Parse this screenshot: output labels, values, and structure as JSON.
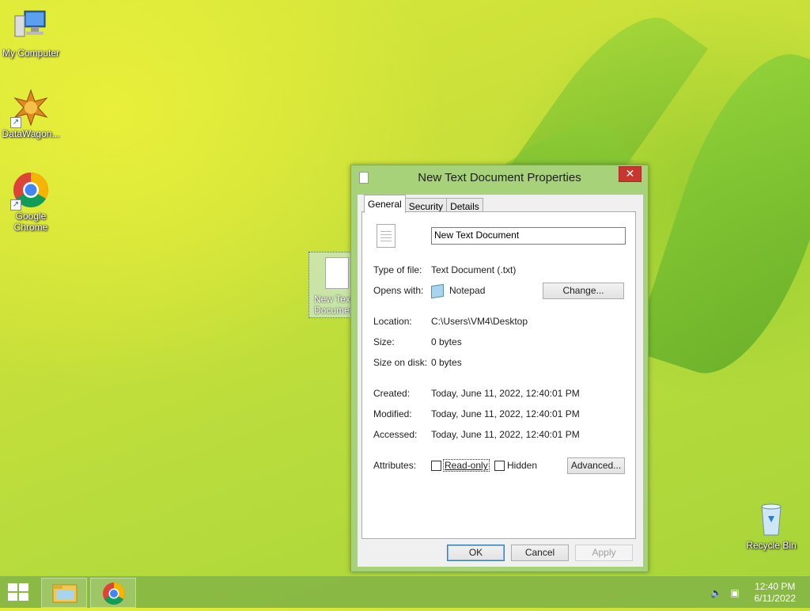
{
  "desktop": {
    "icons": [
      {
        "label": "My Computer"
      },
      {
        "label": "DataWagon..."
      },
      {
        "label": "Google Chrome"
      },
      {
        "label": "New Text Document"
      },
      {
        "label": "Recycle Bin"
      }
    ]
  },
  "dialog": {
    "title": "New Text Document Properties",
    "close_glyph": "✕",
    "tabs": [
      {
        "label": "General",
        "active": true
      },
      {
        "label": "Security"
      },
      {
        "label": "Details"
      }
    ],
    "general": {
      "file_name": "New Text Document",
      "type_label": "Type of file:",
      "type_value": "Text Document (.txt)",
      "opens_label": "Opens with:",
      "opens_value": "Notepad",
      "change_button": "Change...",
      "location_label": "Location:",
      "location_value": "C:\\Users\\VM4\\Desktop",
      "size_label": "Size:",
      "size_value": "0 bytes",
      "size_disk_label": "Size on disk:",
      "size_disk_value": "0 bytes",
      "created_label": "Created:",
      "created_value": "Today, June 11, 2022, 12:40:01 PM",
      "modified_label": "Modified:",
      "modified_value": "Today, June 11, 2022, 12:40:01 PM",
      "accessed_label": "Accessed:",
      "accessed_value": "Today, June 11, 2022, 12:40:01 PM",
      "attributes_label": "Attributes:",
      "readonly_label": "Read-only",
      "hidden_label": "Hidden",
      "advanced_button": "Advanced..."
    },
    "buttons": {
      "ok": "OK",
      "cancel": "Cancel",
      "apply": "Apply"
    }
  },
  "taskbar": {
    "time": "12:40 PM",
    "date": "6/11/2022"
  },
  "colors": {
    "accent": "#a7d27a",
    "close": "#c7372f"
  }
}
